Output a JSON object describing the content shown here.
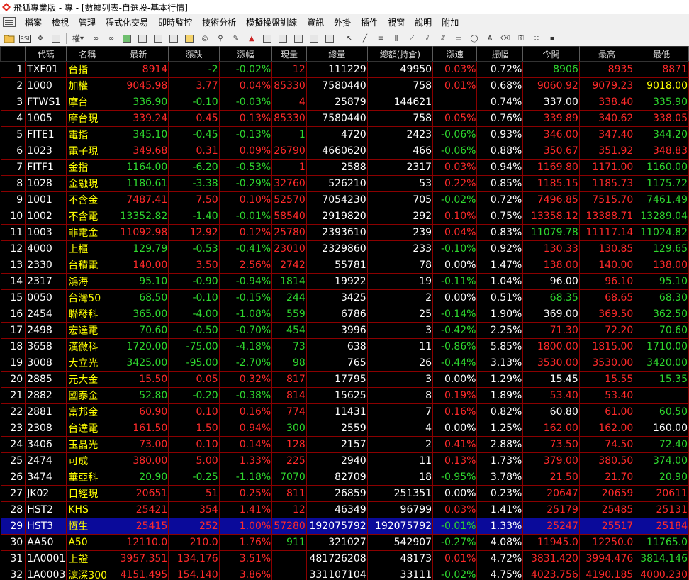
{
  "window": {
    "title": "飛狐專業版 - 專 - [數據列表-自選股-基本行情]"
  },
  "menu": [
    "檔案",
    "檢視",
    "管理",
    "程式化交易",
    "即時監控",
    "技術分析",
    "模擬操盤訓練",
    "資訊",
    "外掛",
    "插件",
    "視窗",
    "說明",
    "附加"
  ],
  "toolbar": {
    "picker_label": "權",
    "rsi_label": "RSI"
  },
  "columns": [
    "",
    "代碼",
    "名稱",
    "最新",
    "漲跌",
    "漲幅",
    "現量",
    "總量",
    "總額(持倉)",
    "漲速",
    "振幅",
    "今開",
    "最高",
    "最低"
  ],
  "colors": {
    "up": "#ff2a2a",
    "down": "#2fd82f",
    "flat": "#ffffff",
    "name": "#ffff00",
    "selected": "#0a0a9a",
    "grid": "#8b0000"
  },
  "rows": [
    {
      "idx": "1",
      "code": "TXF01",
      "name": "台指",
      "last": "8914",
      "chg": "-2",
      "pct": "-0.02%",
      "vol": "12",
      "total": "111229",
      "amount": "49950",
      "speed": "0.03%",
      "amp": "0.72%",
      "open": "8906",
      "high": "8935",
      "low": "8871",
      "c": {
        "last": "up",
        "chg": "dn",
        "pct": "dn",
        "vol": "up",
        "speed": "up",
        "open": "dn",
        "high": "up",
        "low": "up"
      }
    },
    {
      "idx": "2",
      "code": "1000",
      "name": "加權",
      "last": "9045.98",
      "chg": "3.77",
      "pct": "0.04%",
      "vol": "85330",
      "total": "7580440",
      "amount": "758",
      "speed": "0.01%",
      "amp": "0.68%",
      "open": "9060.92",
      "high": "9079.23",
      "low": "9018.00",
      "c": {
        "last": "up",
        "chg": "up",
        "pct": "up",
        "vol": "up",
        "speed": "up",
        "open": "up",
        "high": "up",
        "low": "yl"
      }
    },
    {
      "idx": "3",
      "code": "FTWS1",
      "name": "摩台",
      "last": "336.90",
      "chg": "-0.10",
      "pct": "-0.03%",
      "vol": "4",
      "total": "25879",
      "amount": "144621",
      "speed": "",
      "amp": "0.74%",
      "open": "337.00",
      "high": "338.40",
      "low": "335.90",
      "c": {
        "last": "dn",
        "chg": "dn",
        "pct": "dn",
        "vol": "up",
        "speed": "wh",
        "open": "wh",
        "high": "up",
        "low": "dn"
      }
    },
    {
      "idx": "4",
      "code": "1005",
      "name": "摩台現",
      "last": "339.24",
      "chg": "0.45",
      "pct": "0.13%",
      "vol": "85330",
      "total": "7580440",
      "amount": "758",
      "speed": "0.05%",
      "amp": "0.76%",
      "open": "339.89",
      "high": "340.62",
      "low": "338.05",
      "c": {
        "last": "up",
        "chg": "up",
        "pct": "up",
        "vol": "up",
        "speed": "up",
        "open": "up",
        "high": "up",
        "low": "up"
      }
    },
    {
      "idx": "5",
      "code": "FITE1",
      "name": "電指",
      "last": "345.10",
      "chg": "-0.45",
      "pct": "-0.13%",
      "vol": "1",
      "total": "4720",
      "amount": "2423",
      "speed": "-0.06%",
      "amp": "0.93%",
      "open": "346.00",
      "high": "347.40",
      "low": "344.20",
      "c": {
        "last": "dn",
        "chg": "dn",
        "pct": "dn",
        "vol": "dn",
        "speed": "dn",
        "open": "up",
        "high": "up",
        "low": "dn"
      }
    },
    {
      "idx": "6",
      "code": "1023",
      "name": "電子現",
      "last": "349.68",
      "chg": "0.31",
      "pct": "0.09%",
      "vol": "26790",
      "total": "4660620",
      "amount": "466",
      "speed": "-0.06%",
      "amp": "0.88%",
      "open": "350.67",
      "high": "351.92",
      "low": "348.83",
      "c": {
        "last": "up",
        "chg": "up",
        "pct": "up",
        "vol": "up",
        "speed": "dn",
        "open": "up",
        "high": "up",
        "low": "up"
      }
    },
    {
      "idx": "7",
      "code": "FITF1",
      "name": "金指",
      "last": "1164.00",
      "chg": "-6.20",
      "pct": "-0.53%",
      "vol": "1",
      "total": "2588",
      "amount": "2317",
      "speed": "0.03%",
      "amp": "0.94%",
      "open": "1169.80",
      "high": "1171.00",
      "low": "1160.00",
      "c": {
        "last": "dn",
        "chg": "dn",
        "pct": "dn",
        "vol": "up",
        "speed": "up",
        "open": "up",
        "high": "up",
        "low": "dn"
      }
    },
    {
      "idx": "8",
      "code": "1028",
      "name": "金融現",
      "last": "1180.61",
      "chg": "-3.38",
      "pct": "-0.29%",
      "vol": "32760",
      "total": "526210",
      "amount": "53",
      "speed": "0.22%",
      "amp": "0.85%",
      "open": "1185.15",
      "high": "1185.73",
      "low": "1175.72",
      "c": {
        "last": "dn",
        "chg": "dn",
        "pct": "dn",
        "vol": "up",
        "speed": "up",
        "open": "up",
        "high": "up",
        "low": "dn"
      }
    },
    {
      "idx": "9",
      "code": "1001",
      "name": "不含金",
      "last": "7487.41",
      "chg": "7.50",
      "pct": "0.10%",
      "vol": "52570",
      "total": "7054230",
      "amount": "705",
      "speed": "-0.02%",
      "amp": "0.72%",
      "open": "7496.85",
      "high": "7515.70",
      "low": "7461.49",
      "c": {
        "last": "up",
        "chg": "up",
        "pct": "up",
        "vol": "up",
        "speed": "dn",
        "open": "up",
        "high": "up",
        "low": "dn"
      }
    },
    {
      "idx": "10",
      "code": "1002",
      "name": "不含電",
      "last": "13352.82",
      "chg": "-1.40",
      "pct": "-0.01%",
      "vol": "58540",
      "total": "2919820",
      "amount": "292",
      "speed": "0.10%",
      "amp": "0.75%",
      "open": "13358.12",
      "high": "13388.71",
      "low": "13289.04",
      "c": {
        "last": "dn",
        "chg": "dn",
        "pct": "dn",
        "vol": "up",
        "speed": "up",
        "open": "up",
        "high": "up",
        "low": "dn"
      }
    },
    {
      "idx": "11",
      "code": "1003",
      "name": "非電金",
      "last": "11092.98",
      "chg": "12.92",
      "pct": "0.12%",
      "vol": "25780",
      "total": "2393610",
      "amount": "239",
      "speed": "0.04%",
      "amp": "0.83%",
      "open": "11079.78",
      "high": "11117.14",
      "low": "11024.82",
      "c": {
        "last": "up",
        "chg": "up",
        "pct": "up",
        "vol": "up",
        "speed": "up",
        "open": "dn",
        "high": "up",
        "low": "dn"
      }
    },
    {
      "idx": "12",
      "code": "4000",
      "name": "上櫃",
      "last": "129.79",
      "chg": "-0.53",
      "pct": "-0.41%",
      "vol": "23010",
      "total": "2329860",
      "amount": "233",
      "speed": "-0.10%",
      "amp": "0.92%",
      "open": "130.33",
      "high": "130.85",
      "low": "129.65",
      "c": {
        "last": "dn",
        "chg": "dn",
        "pct": "dn",
        "vol": "up",
        "speed": "dn",
        "open": "up",
        "high": "up",
        "low": "dn"
      }
    },
    {
      "idx": "13",
      "code": "2330",
      "name": "台積電",
      "last": "140.00",
      "chg": "3.50",
      "pct": "2.56%",
      "vol": "2742",
      "total": "55781",
      "amount": "78",
      "speed": "0.00%",
      "amp": "1.47%",
      "open": "138.00",
      "high": "140.00",
      "low": "138.00",
      "c": {
        "last": "up",
        "chg": "up",
        "pct": "up",
        "vol": "up",
        "speed": "wh",
        "open": "up",
        "high": "up",
        "low": "up"
      }
    },
    {
      "idx": "14",
      "code": "2317",
      "name": "鴻海",
      "last": "95.10",
      "chg": "-0.90",
      "pct": "-0.94%",
      "vol": "1814",
      "total": "19922",
      "amount": "19",
      "speed": "-0.11%",
      "amp": "1.04%",
      "open": "96.00",
      "high": "96.10",
      "low": "95.10",
      "c": {
        "last": "dn",
        "chg": "dn",
        "pct": "dn",
        "vol": "dn",
        "speed": "dn",
        "open": "wh",
        "high": "up",
        "low": "dn"
      }
    },
    {
      "idx": "15",
      "code": "0050",
      "name": "台灣50",
      "last": "68.50",
      "chg": "-0.10",
      "pct": "-0.15%",
      "vol": "244",
      "total": "3425",
      "amount": "2",
      "speed": "0.00%",
      "amp": "0.51%",
      "open": "68.35",
      "high": "68.65",
      "low": "68.30",
      "c": {
        "last": "dn",
        "chg": "dn",
        "pct": "dn",
        "vol": "dn",
        "speed": "wh",
        "open": "dn",
        "high": "up",
        "low": "dn"
      }
    },
    {
      "idx": "16",
      "code": "2454",
      "name": "聯發科",
      "last": "365.00",
      "chg": "-4.00",
      "pct": "-1.08%",
      "vol": "559",
      "total": "6786",
      "amount": "25",
      "speed": "-0.14%",
      "amp": "1.90%",
      "open": "369.00",
      "high": "369.50",
      "low": "362.50",
      "c": {
        "last": "dn",
        "chg": "dn",
        "pct": "dn",
        "vol": "dn",
        "speed": "dn",
        "open": "wh",
        "high": "up",
        "low": "dn"
      }
    },
    {
      "idx": "17",
      "code": "2498",
      "name": "宏達電",
      "last": "70.60",
      "chg": "-0.50",
      "pct": "-0.70%",
      "vol": "454",
      "total": "3996",
      "amount": "3",
      "speed": "-0.42%",
      "amp": "2.25%",
      "open": "71.30",
      "high": "72.20",
      "low": "70.60",
      "c": {
        "last": "dn",
        "chg": "dn",
        "pct": "dn",
        "vol": "dn",
        "speed": "dn",
        "open": "up",
        "high": "up",
        "low": "dn"
      }
    },
    {
      "idx": "18",
      "code": "3658",
      "name": "漢微科",
      "last": "1720.00",
      "chg": "-75.00",
      "pct": "-4.18%",
      "vol": "73",
      "total": "638",
      "amount": "11",
      "speed": "-0.86%",
      "amp": "5.85%",
      "open": "1800.00",
      "high": "1815.00",
      "low": "1710.00",
      "c": {
        "last": "dn",
        "chg": "dn",
        "pct": "dn",
        "vol": "dn",
        "speed": "dn",
        "open": "up",
        "high": "up",
        "low": "dn"
      }
    },
    {
      "idx": "19",
      "code": "3008",
      "name": "大立光",
      "last": "3425.00",
      "chg": "-95.00",
      "pct": "-2.70%",
      "vol": "98",
      "total": "765",
      "amount": "26",
      "speed": "-0.44%",
      "amp": "3.13%",
      "open": "3530.00",
      "high": "3530.00",
      "low": "3420.00",
      "c": {
        "last": "dn",
        "chg": "dn",
        "pct": "dn",
        "vol": "dn",
        "speed": "dn",
        "open": "up",
        "high": "up",
        "low": "dn"
      }
    },
    {
      "idx": "20",
      "code": "2885",
      "name": "元大金",
      "last": "15.50",
      "chg": "0.05",
      "pct": "0.32%",
      "vol": "817",
      "total": "17795",
      "amount": "3",
      "speed": "0.00%",
      "amp": "1.29%",
      "open": "15.45",
      "high": "15.55",
      "low": "15.35",
      "c": {
        "last": "up",
        "chg": "up",
        "pct": "up",
        "vol": "up",
        "speed": "wh",
        "open": "wh",
        "high": "up",
        "low": "dn"
      }
    },
    {
      "idx": "21",
      "code": "2882",
      "name": "國泰金",
      "last": "52.80",
      "chg": "-0.20",
      "pct": "-0.38%",
      "vol": "814",
      "total": "15625",
      "amount": "8",
      "speed": "0.19%",
      "amp": "1.89%",
      "open": "53.40",
      "high": "53.40",
      "low": "",
      "c": {
        "last": "dn",
        "chg": "dn",
        "pct": "dn",
        "vol": "up",
        "speed": "up",
        "open": "up",
        "high": "up",
        "low": "dn"
      }
    },
    {
      "idx": "22",
      "code": "2881",
      "name": "富邦金",
      "last": "60.90",
      "chg": "0.10",
      "pct": "0.16%",
      "vol": "774",
      "total": "11431",
      "amount": "7",
      "speed": "0.16%",
      "amp": "0.82%",
      "open": "60.80",
      "high": "61.00",
      "low": "60.50",
      "c": {
        "last": "up",
        "chg": "up",
        "pct": "up",
        "vol": "up",
        "speed": "up",
        "open": "wh",
        "high": "up",
        "low": "dn"
      }
    },
    {
      "idx": "23",
      "code": "2308",
      "name": "台達電",
      "last": "161.50",
      "chg": "1.50",
      "pct": "0.94%",
      "vol": "300",
      "total": "2559",
      "amount": "4",
      "speed": "0.00%",
      "amp": "1.25%",
      "open": "162.00",
      "high": "162.00",
      "low": "160.00",
      "c": {
        "last": "up",
        "chg": "up",
        "pct": "up",
        "vol": "dn",
        "speed": "wh",
        "open": "up",
        "high": "up",
        "low": "wh"
      }
    },
    {
      "idx": "24",
      "code": "3406",
      "name": "玉晶光",
      "last": "73.00",
      "chg": "0.10",
      "pct": "0.14%",
      "vol": "128",
      "total": "2157",
      "amount": "2",
      "speed": "0.41%",
      "amp": "2.88%",
      "open": "73.50",
      "high": "74.50",
      "low": "72.40",
      "c": {
        "last": "up",
        "chg": "up",
        "pct": "up",
        "vol": "up",
        "speed": "up",
        "open": "up",
        "high": "up",
        "low": "dn"
      }
    },
    {
      "idx": "25",
      "code": "2474",
      "name": "可成",
      "last": "380.00",
      "chg": "5.00",
      "pct": "1.33%",
      "vol": "225",
      "total": "2940",
      "amount": "11",
      "speed": "0.13%",
      "amp": "1.73%",
      "open": "379.00",
      "high": "380.50",
      "low": "374.00",
      "c": {
        "last": "up",
        "chg": "up",
        "pct": "up",
        "vol": "up",
        "speed": "up",
        "open": "up",
        "high": "up",
        "low": "dn"
      }
    },
    {
      "idx": "26",
      "code": "3474",
      "name": "華亞科",
      "last": "20.90",
      "chg": "-0.25",
      "pct": "-1.18%",
      "vol": "7070",
      "total": "82709",
      "amount": "18",
      "speed": "-0.95%",
      "amp": "3.78%",
      "open": "21.50",
      "high": "21.70",
      "low": "20.90",
      "c": {
        "last": "dn",
        "chg": "dn",
        "pct": "dn",
        "vol": "dn",
        "speed": "dn",
        "open": "up",
        "high": "up",
        "low": "dn"
      }
    },
    {
      "idx": "27",
      "code": "JK02",
      "name": "日經現",
      "last": "20651",
      "chg": "51",
      "pct": "0.25%",
      "vol": "811",
      "total": "26859",
      "amount": "251351",
      "speed": "0.00%",
      "amp": "0.23%",
      "open": "20647",
      "high": "20659",
      "low": "20611",
      "c": {
        "last": "up",
        "chg": "up",
        "pct": "up",
        "vol": "up",
        "speed": "wh",
        "open": "up",
        "high": "up",
        "low": "up"
      }
    },
    {
      "idx": "28",
      "code": "HST2",
      "name": "KHS",
      "last": "25421",
      "chg": "354",
      "pct": "1.41%",
      "vol": "12",
      "total": "46349",
      "amount": "96799",
      "speed": "0.03%",
      "amp": "1.41%",
      "open": "25179",
      "high": "25485",
      "low": "25131",
      "c": {
        "last": "up",
        "chg": "up",
        "pct": "up",
        "vol": "up",
        "speed": "up",
        "open": "up",
        "high": "up",
        "low": "up"
      }
    },
    {
      "idx": "29",
      "code": "HST3",
      "name": "恆生",
      "last": "25415",
      "chg": "252",
      "pct": "1.00%",
      "vol": "57280",
      "total": "192075792",
      "amount": "192075792",
      "speed": "-0.01%",
      "amp": "1.33%",
      "open": "25247",
      "high": "25517",
      "low": "25184",
      "c": {
        "last": "up",
        "chg": "up",
        "pct": "up",
        "vol": "up",
        "speed": "dn",
        "open": "up",
        "high": "up",
        "low": "up"
      }
    },
    {
      "idx": "30",
      "code": "AA50",
      "name": "A50",
      "last": "12110.0",
      "chg": "210.0",
      "pct": "1.76%",
      "vol": "911",
      "total": "321027",
      "amount": "542907",
      "speed": "-0.27%",
      "amp": "4.08%",
      "open": "11945.0",
      "high": "12250.0",
      "low": "11765.0",
      "c": {
        "last": "up",
        "chg": "up",
        "pct": "up",
        "vol": "dn",
        "speed": "dn",
        "open": "up",
        "high": "up",
        "low": "dn"
      }
    },
    {
      "idx": "31",
      "code": "1A0001",
      "name": "上證",
      "last": "3957.351",
      "chg": "134.176",
      "pct": "3.51%",
      "vol": "",
      "total": "481726208",
      "amount": "48173",
      "speed": "0.01%",
      "amp": "4.72%",
      "open": "3831.420",
      "high": "3994.476",
      "low": "3814.146",
      "c": {
        "last": "up",
        "chg": "up",
        "pct": "up",
        "vol": "up",
        "speed": "up",
        "open": "up",
        "high": "up",
        "low": "dn"
      }
    },
    {
      "idx": "32",
      "code": "1A0003",
      "name": "滬深300",
      "last": "4151.495",
      "chg": "154.140",
      "pct": "3.86%",
      "vol": "",
      "total": "331107104",
      "amount": "33111",
      "speed": "-0.02%",
      "amp": "4.75%",
      "open": "4023.756",
      "high": "4190.185",
      "low": "4000.230",
      "c": {
        "last": "up",
        "chg": "up",
        "pct": "up",
        "vol": "up",
        "speed": "dn",
        "open": "up",
        "high": "up",
        "low": "up"
      }
    }
  ]
}
